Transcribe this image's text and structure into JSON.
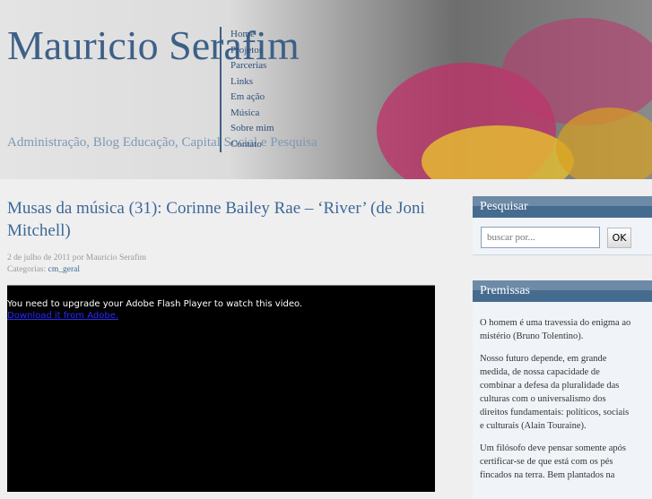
{
  "header": {
    "title": "Mauricio Serafim",
    "tagline": "Administração, Blog Educação, Capital Social e Pesquisa"
  },
  "nav": [
    "Home",
    "Projetos",
    "Parcerias",
    "Links",
    "Em ação",
    "Música",
    "Sobre mim",
    "Contato"
  ],
  "post": {
    "title": "Musas da música (31): Corinne Bailey Rae – ‘River’ (de Joni Mitchell)",
    "date_line": "2 de julho de 2011 por Mauricio Serafim",
    "categories_label": "Categorias:",
    "category": "cm_geral",
    "flash_message": "You need to upgrade your Adobe Flash Player to watch this video.",
    "flash_link": "Download it from Adobe."
  },
  "sidebar": {
    "search_title": "Pesquisar",
    "search_placeholder": "buscar por...",
    "search_button": "OK",
    "premissas_title": "Premissas",
    "quotes": [
      "O homem é uma travessia do enigma ao mistério (Bruno Tolentino).",
      "Nosso futuro depende, em grande medida, de nossa capacidade de combinar a defesa da pluralidade das culturas com o universalismo dos direitos fundamentais: políticos, sociais e culturais (Alain Touraine).",
      "Um filósofo deve pensar somente após certificar-se de que está com os pés fincados na terra. Bem plantados na"
    ]
  }
}
